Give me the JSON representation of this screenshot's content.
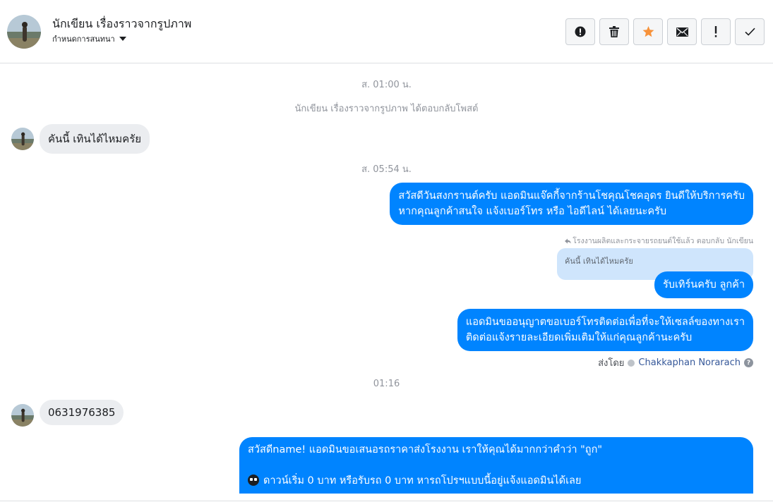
{
  "header": {
    "name": "นักเขียน เรื่องราวจากรูปภาพ",
    "subtitle": "กำหนดการสนทนา",
    "actions": [
      {
        "name": "report-button",
        "icon": "alert-circle-icon"
      },
      {
        "name": "delete-button",
        "icon": "trash-icon"
      },
      {
        "name": "star-button",
        "icon": "star-icon"
      },
      {
        "name": "mail-button",
        "icon": "envelope-icon"
      },
      {
        "name": "important-button",
        "icon": "exclamation-icon"
      },
      {
        "name": "done-button",
        "icon": "check-icon"
      }
    ]
  },
  "messages": {
    "ts1": "ส. 01:00 น.",
    "system1": "นักเขียน เรื่องราวจากรูปภาพ ได้ตอบกลับโพสต์",
    "in1": "คันนี้ เทินได้ไหมครัย",
    "ts2": "ส. 05:54 น.",
    "out1_line1": "สวัสดีวันสงกรานต์ครับ แอดมินแจ๊คกี้จากร้านโชคุณโชคอุดร ยินดีให้บริการครับ",
    "out1_line2": "หากคุณลูกค้าสนใจ แจ้งเบอร์โทร หรือ ไอดีไลน์ ได้เลยนะครับ",
    "reply_meta": "โรงงานผลิตและกระจายรถยนต์ใช้แล้ว ตอบกลับ นักเขียน",
    "reply_quote": "คันนี้ เทินได้ไหมครัย",
    "out2": "รับเทิร์นครับ ลูกค้า",
    "out3_line1": "แอดมินขออนุญาตขอเบอร์โทรติดต่อเพื่อที่จะให้เซลล์ของทางเรา",
    "out3_line2": "ติดต่อแจ้งรายละเอียดเพิ่มเติมให้แก่คุณลูกค้านะครับ",
    "sent_by_label": "ส่งโดย",
    "sent_by_name": "Chakkaphan Norarach",
    "ts3": "01:16",
    "in2": "0631976385",
    "out4_line1": "สวัสดีname! แอดมินขอเสนอรถราคาส่งโรงงาน เราให้คุณได้มากกว่าคำว่า \"ถูก\"",
    "out4_line3": "ดาวน์เริ่ม 0 บาท หรือรับรถ 0 บาท หารถโปรฯแบบนี้อยู่แจ้งแอดมินได้เลย"
  },
  "colors": {
    "outgoing": "#0084ff",
    "incoming": "#ebedf0",
    "star": "#f7923a"
  }
}
